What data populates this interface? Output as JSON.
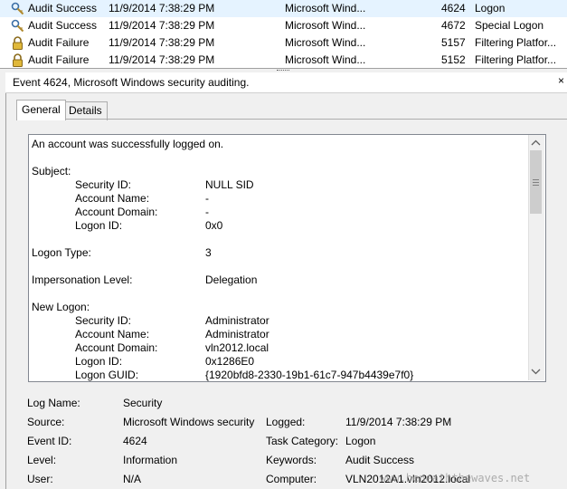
{
  "events": [
    {
      "keyword": "Audit Success",
      "date": "11/9/2014 7:38:29 PM",
      "source": "Microsoft Wind...",
      "id": "4624",
      "task": "Logon",
      "icon": "key-icon",
      "selected": true
    },
    {
      "keyword": "Audit Success",
      "date": "11/9/2014 7:38:29 PM",
      "source": "Microsoft Wind...",
      "id": "4672",
      "task": "Special Logon",
      "icon": "key-icon",
      "selected": false
    },
    {
      "keyword": "Audit Failure",
      "date": "11/9/2014 7:38:29 PM",
      "source": "Microsoft Wind...",
      "id": "5157",
      "task": "Filtering Platfor...",
      "icon": "lock-icon",
      "selected": false
    },
    {
      "keyword": "Audit Failure",
      "date": "11/9/2014 7:38:29 PM",
      "source": "Microsoft Wind...",
      "id": "5152",
      "task": "Filtering Platfor...",
      "icon": "lock-icon",
      "selected": false
    }
  ],
  "details": {
    "title": "Event 4624, Microsoft Windows security auditing.",
    "close": "×",
    "tabs": {
      "general": "General",
      "details": "Details"
    },
    "message": {
      "l1": "An account was successfully logged on.",
      "subject": "Subject:",
      "sec_id_l": "Security ID:",
      "sec_id_v": "NULL SID",
      "acct_name_l": "Account Name:",
      "acct_name_v": "-",
      "acct_dom_l": "Account Domain:",
      "acct_dom_v": "-",
      "logon_id_l": "Logon ID:",
      "logon_id_v": "0x0",
      "logon_type_l": "Logon Type:",
      "logon_type_v": "3",
      "imp_l": "Impersonation Level:",
      "imp_v": "Delegation",
      "new_logon": "New Logon:",
      "n_sec_id_l": "Security ID:",
      "n_sec_id_v": "Administrator",
      "n_acct_name_l": "Account Name:",
      "n_acct_name_v": "Administrator",
      "n_acct_dom_l": "Account Domain:",
      "n_acct_dom_v": "vln2012.local",
      "n_logon_id_l": "Logon ID:",
      "n_logon_id_v": "0x1286E0",
      "n_guid_l": "Logon GUID:",
      "n_guid_v": "{1920bfd8-2330-19b1-61c7-947b4439e7f0}"
    },
    "props": {
      "log_name_l": "Log Name:",
      "log_name_v": "Security",
      "source_l": "Source:",
      "source_v": "Microsoft Windows security",
      "logged_l": "Logged:",
      "logged_v": "11/9/2014 7:38:29 PM",
      "event_id_l": "Event ID:",
      "event_id_v": "4624",
      "task_l": "Task Category:",
      "task_v": "Logon",
      "level_l": "Level:",
      "level_v": "Information",
      "keywords_l": "Keywords:",
      "keywords_v": "Audit Success",
      "user_l": "User:",
      "user_v": "N/A",
      "computer_l": "Computer:",
      "computer_v": "VLN2012A1.vln2012.local"
    }
  },
  "watermark": "www.beneaththewaves.net",
  "colors": {
    "selection": "#e5f3ff",
    "border": "#828790"
  }
}
